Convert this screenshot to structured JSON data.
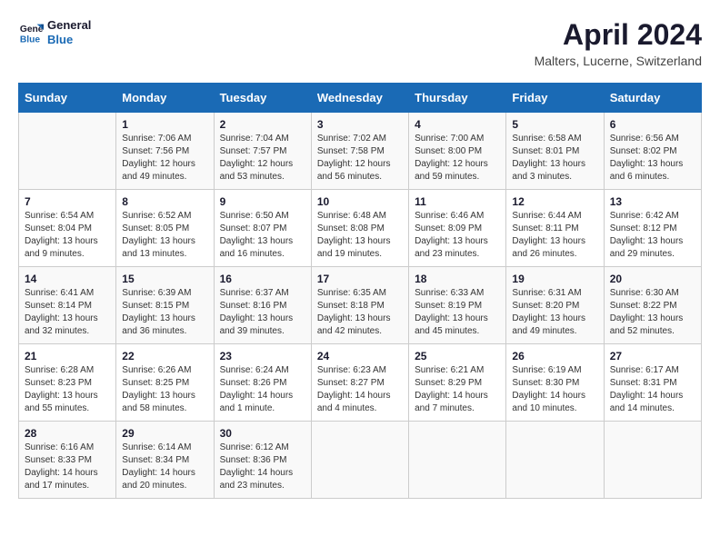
{
  "header": {
    "logo_line1": "General",
    "logo_line2": "Blue",
    "main_title": "April 2024",
    "subtitle": "Malters, Lucerne, Switzerland"
  },
  "calendar": {
    "days_of_week": [
      "Sunday",
      "Monday",
      "Tuesday",
      "Wednesday",
      "Thursday",
      "Friday",
      "Saturday"
    ],
    "weeks": [
      [
        {
          "day": null,
          "info": null
        },
        {
          "day": "1",
          "info": "Sunrise: 7:06 AM\nSunset: 7:56 PM\nDaylight: 12 hours\nand 49 minutes."
        },
        {
          "day": "2",
          "info": "Sunrise: 7:04 AM\nSunset: 7:57 PM\nDaylight: 12 hours\nand 53 minutes."
        },
        {
          "day": "3",
          "info": "Sunrise: 7:02 AM\nSunset: 7:58 PM\nDaylight: 12 hours\nand 56 minutes."
        },
        {
          "day": "4",
          "info": "Sunrise: 7:00 AM\nSunset: 8:00 PM\nDaylight: 12 hours\nand 59 minutes."
        },
        {
          "day": "5",
          "info": "Sunrise: 6:58 AM\nSunset: 8:01 PM\nDaylight: 13 hours\nand 3 minutes."
        },
        {
          "day": "6",
          "info": "Sunrise: 6:56 AM\nSunset: 8:02 PM\nDaylight: 13 hours\nand 6 minutes."
        }
      ],
      [
        {
          "day": "7",
          "info": "Sunrise: 6:54 AM\nSunset: 8:04 PM\nDaylight: 13 hours\nand 9 minutes."
        },
        {
          "day": "8",
          "info": "Sunrise: 6:52 AM\nSunset: 8:05 PM\nDaylight: 13 hours\nand 13 minutes."
        },
        {
          "day": "9",
          "info": "Sunrise: 6:50 AM\nSunset: 8:07 PM\nDaylight: 13 hours\nand 16 minutes."
        },
        {
          "day": "10",
          "info": "Sunrise: 6:48 AM\nSunset: 8:08 PM\nDaylight: 13 hours\nand 19 minutes."
        },
        {
          "day": "11",
          "info": "Sunrise: 6:46 AM\nSunset: 8:09 PM\nDaylight: 13 hours\nand 23 minutes."
        },
        {
          "day": "12",
          "info": "Sunrise: 6:44 AM\nSunset: 8:11 PM\nDaylight: 13 hours\nand 26 minutes."
        },
        {
          "day": "13",
          "info": "Sunrise: 6:42 AM\nSunset: 8:12 PM\nDaylight: 13 hours\nand 29 minutes."
        }
      ],
      [
        {
          "day": "14",
          "info": "Sunrise: 6:41 AM\nSunset: 8:14 PM\nDaylight: 13 hours\nand 32 minutes."
        },
        {
          "day": "15",
          "info": "Sunrise: 6:39 AM\nSunset: 8:15 PM\nDaylight: 13 hours\nand 36 minutes."
        },
        {
          "day": "16",
          "info": "Sunrise: 6:37 AM\nSunset: 8:16 PM\nDaylight: 13 hours\nand 39 minutes."
        },
        {
          "day": "17",
          "info": "Sunrise: 6:35 AM\nSunset: 8:18 PM\nDaylight: 13 hours\nand 42 minutes."
        },
        {
          "day": "18",
          "info": "Sunrise: 6:33 AM\nSunset: 8:19 PM\nDaylight: 13 hours\nand 45 minutes."
        },
        {
          "day": "19",
          "info": "Sunrise: 6:31 AM\nSunset: 8:20 PM\nDaylight: 13 hours\nand 49 minutes."
        },
        {
          "day": "20",
          "info": "Sunrise: 6:30 AM\nSunset: 8:22 PM\nDaylight: 13 hours\nand 52 minutes."
        }
      ],
      [
        {
          "day": "21",
          "info": "Sunrise: 6:28 AM\nSunset: 8:23 PM\nDaylight: 13 hours\nand 55 minutes."
        },
        {
          "day": "22",
          "info": "Sunrise: 6:26 AM\nSunset: 8:25 PM\nDaylight: 13 hours\nand 58 minutes."
        },
        {
          "day": "23",
          "info": "Sunrise: 6:24 AM\nSunset: 8:26 PM\nDaylight: 14 hours\nand 1 minute."
        },
        {
          "day": "24",
          "info": "Sunrise: 6:23 AM\nSunset: 8:27 PM\nDaylight: 14 hours\nand 4 minutes."
        },
        {
          "day": "25",
          "info": "Sunrise: 6:21 AM\nSunset: 8:29 PM\nDaylight: 14 hours\nand 7 minutes."
        },
        {
          "day": "26",
          "info": "Sunrise: 6:19 AM\nSunset: 8:30 PM\nDaylight: 14 hours\nand 10 minutes."
        },
        {
          "day": "27",
          "info": "Sunrise: 6:17 AM\nSunset: 8:31 PM\nDaylight: 14 hours\nand 14 minutes."
        }
      ],
      [
        {
          "day": "28",
          "info": "Sunrise: 6:16 AM\nSunset: 8:33 PM\nDaylight: 14 hours\nand 17 minutes."
        },
        {
          "day": "29",
          "info": "Sunrise: 6:14 AM\nSunset: 8:34 PM\nDaylight: 14 hours\nand 20 minutes."
        },
        {
          "day": "30",
          "info": "Sunrise: 6:12 AM\nSunset: 8:36 PM\nDaylight: 14 hours\nand 23 minutes."
        },
        {
          "day": null,
          "info": null
        },
        {
          "day": null,
          "info": null
        },
        {
          "day": null,
          "info": null
        },
        {
          "day": null,
          "info": null
        }
      ]
    ]
  }
}
